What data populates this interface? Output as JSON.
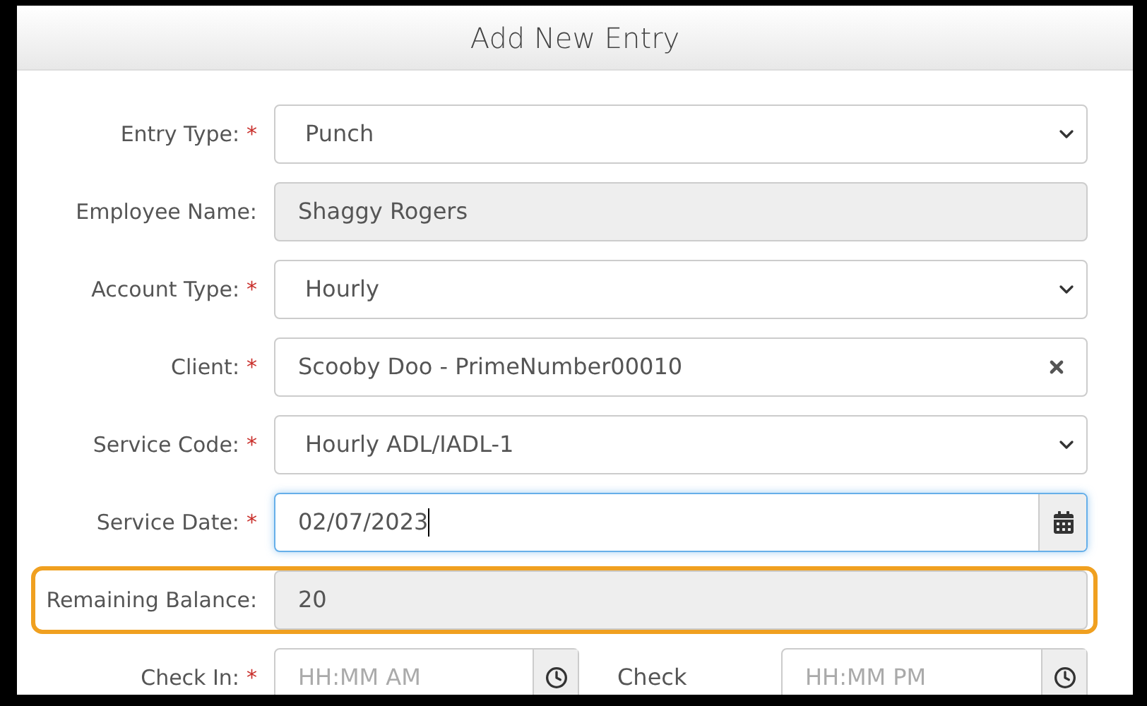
{
  "dialog": {
    "title": "Add New Entry"
  },
  "fields": [
    {
      "kind": "select",
      "label": "Entry Type:",
      "required_mark": "*",
      "value": "Punch"
    },
    {
      "kind": "readonly",
      "label": "Employee Name:",
      "value": "Shaggy Rogers"
    },
    {
      "kind": "select",
      "label": "Account Type:",
      "required_mark": "*",
      "value": "Hourly"
    },
    {
      "kind": "clearable",
      "label": "Client:",
      "required_mark": "*",
      "value": "Scooby Doo - PrimeNumber00010"
    },
    {
      "kind": "select",
      "label": "Service Code:",
      "required_mark": "*",
      "value": "Hourly ADL/IADL-1"
    },
    {
      "kind": "date",
      "label": "Service Date:",
      "required_mark": "*",
      "value": "02/07/2023",
      "focused": true
    },
    {
      "kind": "readonly",
      "label": "Remaining Balance:",
      "value": "20",
      "highlighted": true
    },
    {
      "kind": "time_pair",
      "label": "Check In:",
      "required_mark": "*",
      "placeholder": "HH:MM AM",
      "second_label": "Check",
      "second_placeholder": "HH:MM PM"
    }
  ]
}
